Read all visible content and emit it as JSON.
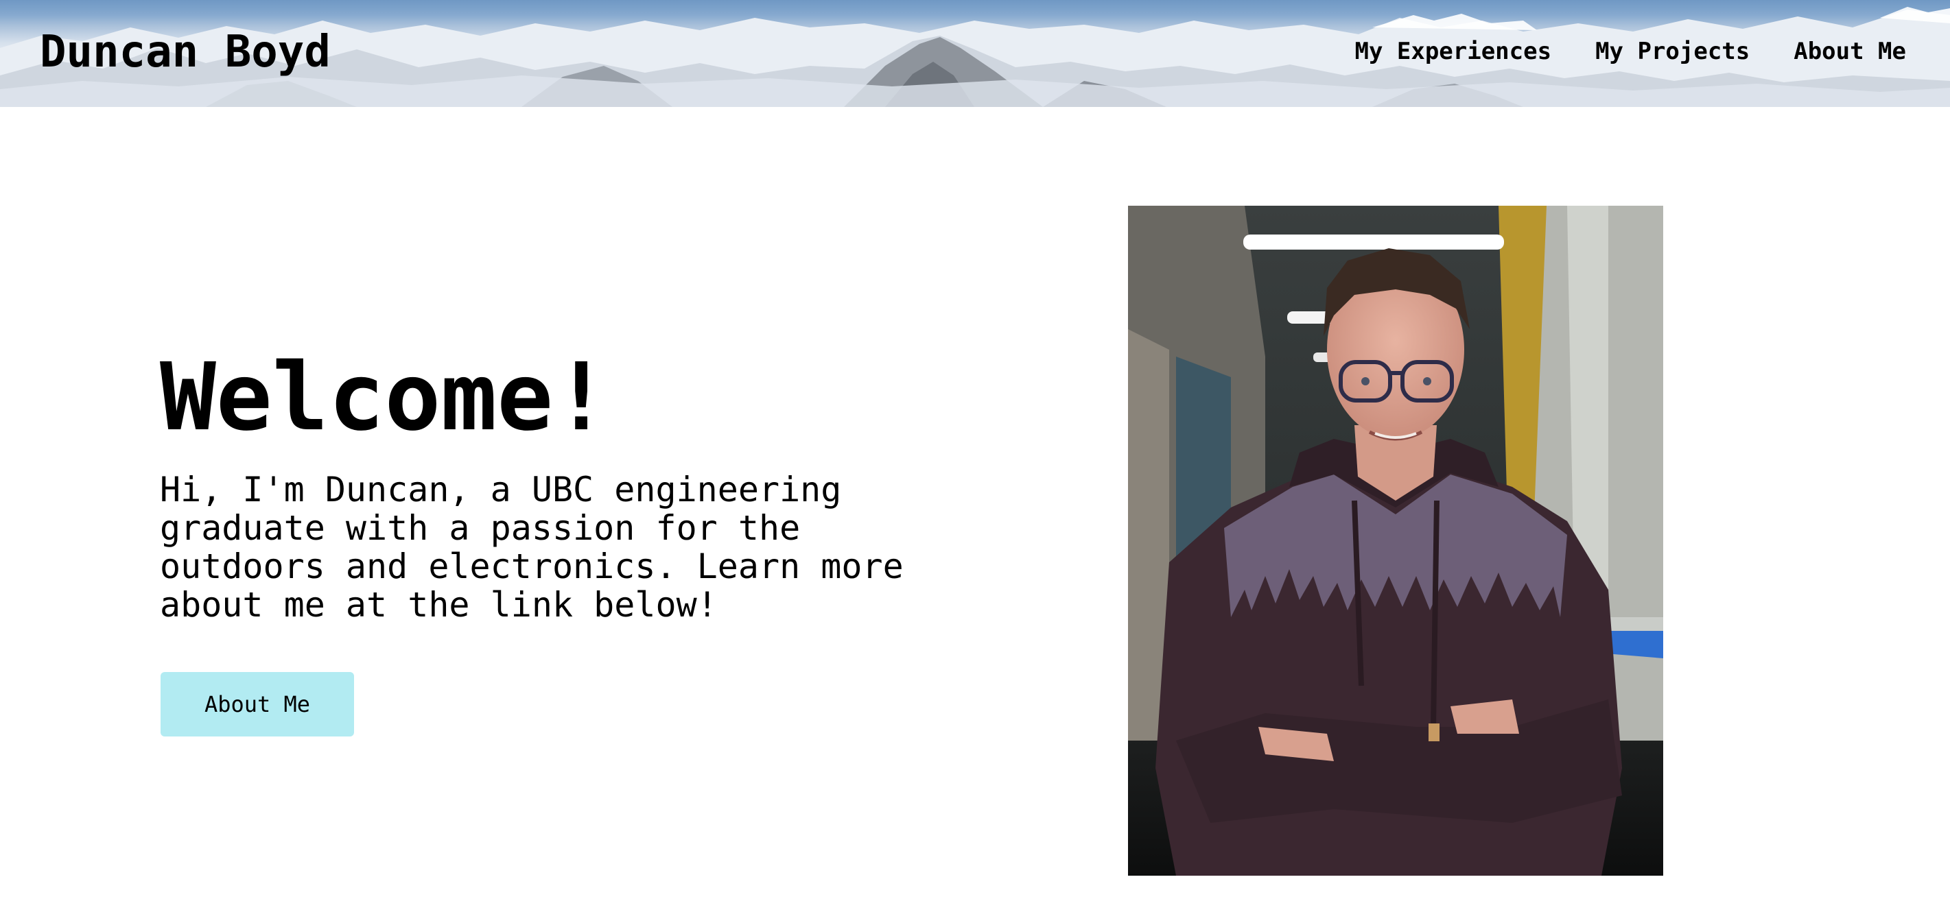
{
  "header": {
    "site_title": "Duncan Boyd",
    "nav": [
      {
        "label": "My Experiences"
      },
      {
        "label": "My Projects"
      },
      {
        "label": "About Me"
      }
    ],
    "banner_image": "snowy-mountain-range"
  },
  "hero": {
    "title": "Welcome!",
    "description": "Hi, I'm Duncan, a UBC engineering graduate with a passion for the outdoors and electronics. Learn more about me at the link below!",
    "button_label": "About Me",
    "button_color": "#b2ebf2"
  },
  "portrait": {
    "image": "portrait-photo",
    "subject": "man with glasses in hoodie with tree pattern, arms crossed, in hallway"
  }
}
